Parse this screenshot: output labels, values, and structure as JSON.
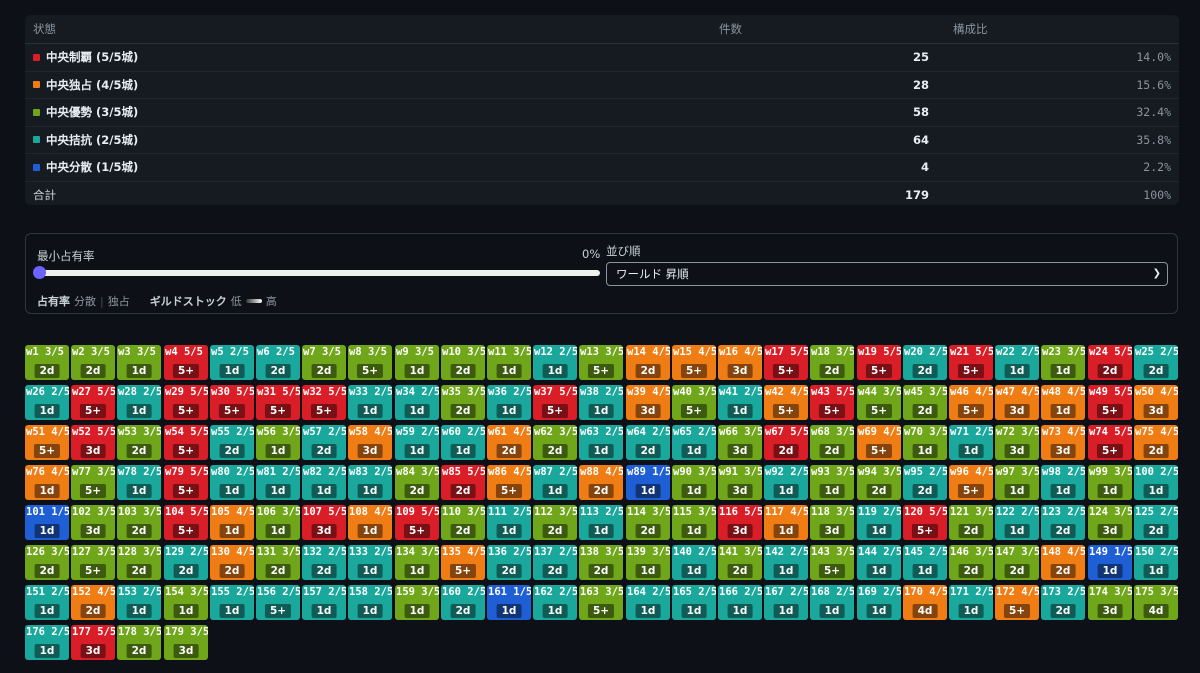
{
  "summary": {
    "headers": {
      "state": "状態",
      "count": "件数",
      "ratio": "構成比"
    },
    "rows": [
      {
        "label": "中央制覇 (5/5城)",
        "count": "25",
        "ratio": "14.0%",
        "color": "#da1e28"
      },
      {
        "label": "中央独占 (4/5城)",
        "count": "28",
        "ratio": "15.6%",
        "color": "#f07d14"
      },
      {
        "label": "中央優勢 (3/5城)",
        "count": "58",
        "ratio": "32.4%",
        "color": "#6fa61a"
      },
      {
        "label": "中央拮抗 (2/5城)",
        "count": "64",
        "ratio": "35.8%",
        "color": "#1ba89c"
      },
      {
        "label": "中央分散 (1/5城)",
        "count": "4",
        "ratio": "2.2%",
        "color": "#1f5fd6"
      }
    ],
    "total": {
      "label": "合計",
      "count": "179",
      "ratio": "100%"
    }
  },
  "controls": {
    "min_occupancy_label": "最小占有率",
    "min_occupancy_value": "0%",
    "min_occupancy_fraction": 0,
    "sort_label": "並び順",
    "sort_value": "ワールド 昇順",
    "legend": {
      "occupancy": "占有率",
      "low_side": "分散",
      "high_side": "独占",
      "stock": "ギルドストック",
      "low": "低",
      "high": "高"
    }
  },
  "colors": {
    "5": "#da1e28",
    "4": "#f07d14",
    "3": "#6fa61a",
    "2": "#1ba89c",
    "1": "#1f5fd6"
  },
  "worlds": [
    "1|3|2d",
    "2|3|2d",
    "3|3|1d",
    "4|5|5+",
    "5|2|1d",
    "6|2|2d",
    "7|3|2d",
    "8|3|5+",
    "9|3|1d",
    "10|3|2d",
    "11|3|1d",
    "12|2|1d",
    "13|3|5+",
    "14|4|2d",
    "15|4|5+",
    "16|4|3d",
    "17|5|5+",
    "18|3|2d",
    "19|5|5+",
    "20|2|2d",
    "21|5|5+",
    "22|2|1d",
    "23|3|1d",
    "24|5|2d",
    "25|2|2d",
    "26|2|1d",
    "27|5|5+",
    "28|2|1d",
    "29|5|5+",
    "30|5|5+",
    "31|5|5+",
    "32|5|5+",
    "33|2|1d",
    "34|2|1d",
    "35|3|2d",
    "36|2|1d",
    "37|5|5+",
    "38|2|1d",
    "39|4|3d",
    "40|3|5+",
    "41|2|1d",
    "42|4|5+",
    "43|5|5+",
    "44|3|5+",
    "45|3|2d",
    "46|4|5+",
    "47|4|3d",
    "48|4|1d",
    "49|5|5+",
    "50|4|3d",
    "51|4|5+",
    "52|5|3d",
    "53|3|2d",
    "54|5|5+",
    "55|2|2d",
    "56|3|1d",
    "57|2|2d",
    "58|4|3d",
    "59|2|1d",
    "60|2|1d",
    "61|4|2d",
    "62|3|2d",
    "63|2|1d",
    "64|2|2d",
    "65|2|1d",
    "66|3|3d",
    "67|5|2d",
    "68|3|2d",
    "69|4|5+",
    "70|3|1d",
    "71|2|1d",
    "72|3|3d",
    "73|4|3d",
    "74|5|5+",
    "75|4|2d",
    "76|4|1d",
    "77|3|5+",
    "78|2|1d",
    "79|5|5+",
    "80|2|1d",
    "81|2|1d",
    "82|2|1d",
    "83|2|1d",
    "84|3|2d",
    "85|5|2d",
    "86|4|5+",
    "87|2|1d",
    "88|4|2d",
    "89|1|1d",
    "90|3|1d",
    "91|3|3d",
    "92|2|1d",
    "93|3|1d",
    "94|3|2d",
    "95|2|2d",
    "96|4|5+",
    "97|3|1d",
    "98|2|1d",
    "99|3|1d",
    "100|2|1d",
    "101|1|1d",
    "102|3|3d",
    "103|3|2d",
    "104|5|5+",
    "105|4|1d",
    "106|3|1d",
    "107|5|3d",
    "108|4|1d",
    "109|5|5+",
    "110|3|2d",
    "111|2|1d",
    "112|3|2d",
    "113|2|1d",
    "114|3|2d",
    "115|3|1d",
    "116|5|3d",
    "117|4|1d",
    "118|3|3d",
    "119|2|1d",
    "120|5|5+",
    "121|3|2d",
    "122|2|1d",
    "123|2|2d",
    "124|3|3d",
    "125|2|2d",
    "126|3|2d",
    "127|3|5+",
    "128|3|2d",
    "129|2|2d",
    "130|4|2d",
    "131|3|2d",
    "132|2|2d",
    "133|2|1d",
    "134|3|1d",
    "135|4|5+",
    "136|2|2d",
    "137|2|2d",
    "138|3|2d",
    "139|3|1d",
    "140|2|1d",
    "141|3|2d",
    "142|2|1d",
    "143|3|5+",
    "144|2|1d",
    "145|2|1d",
    "146|3|2d",
    "147|3|2d",
    "148|4|2d",
    "149|1|1d",
    "150|2|1d",
    "151|2|1d",
    "152|4|2d",
    "153|2|1d",
    "154|3|1d",
    "155|2|1d",
    "156|2|5+",
    "157|2|1d",
    "158|2|1d",
    "159|3|1d",
    "160|2|2d",
    "161|1|1d",
    "162|2|1d",
    "163|3|5+",
    "164|2|1d",
    "165|2|1d",
    "166|2|1d",
    "167|2|1d",
    "168|2|1d",
    "169|2|1d",
    "170|4|4d",
    "171|2|1d",
    "172|4|5+",
    "173|2|2d",
    "174|3|3d",
    "175|3|4d",
    "176|2|1d",
    "177|5|3d",
    "178|3|2d",
    "179|3|3d"
  ]
}
